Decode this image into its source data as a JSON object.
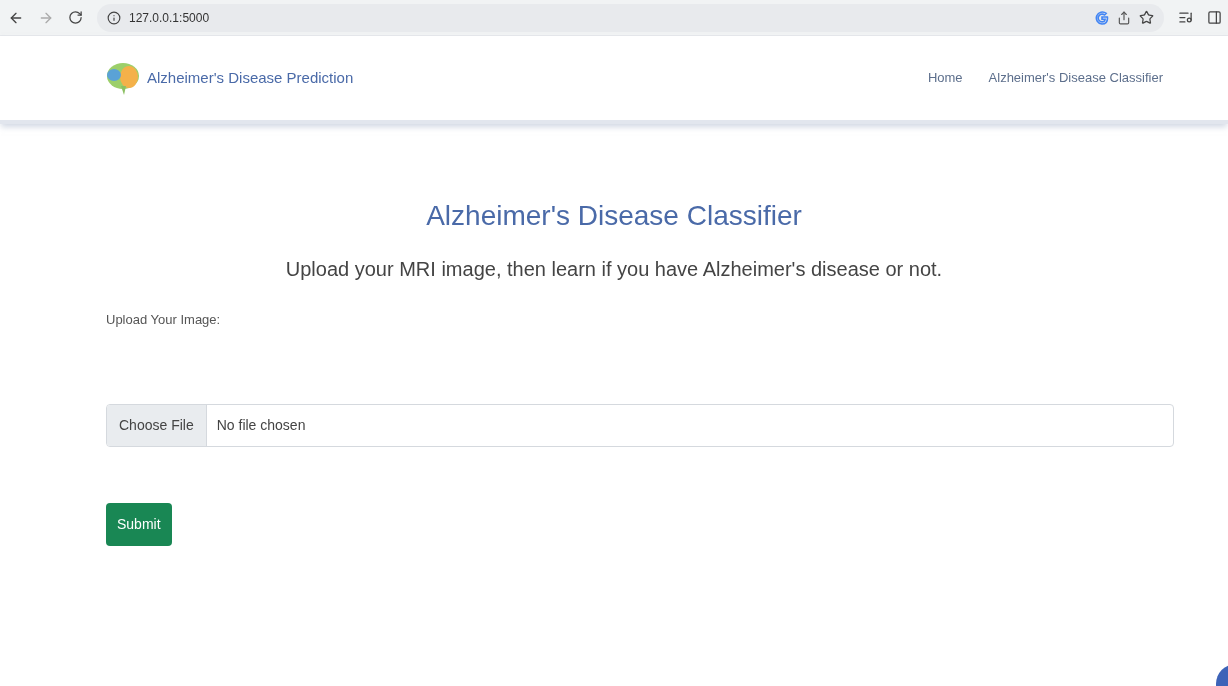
{
  "browser": {
    "url": "127.0.0.1:5000"
  },
  "navbar": {
    "brand": "Alzheimer's Disease Prediction",
    "links": [
      {
        "label": "Home",
        "selected": false
      },
      {
        "label": "Alzheimer's Disease Classifier",
        "selected": false
      }
    ]
  },
  "main": {
    "title": "Alzheimer's Disease Classifier",
    "subtitle": "Upload your MRI image, then learn if you have Alzheimer's disease or not.",
    "upload_label": "Upload Your Image:",
    "file_button": "Choose File",
    "file_status": "No file chosen",
    "submit": "Submit"
  }
}
